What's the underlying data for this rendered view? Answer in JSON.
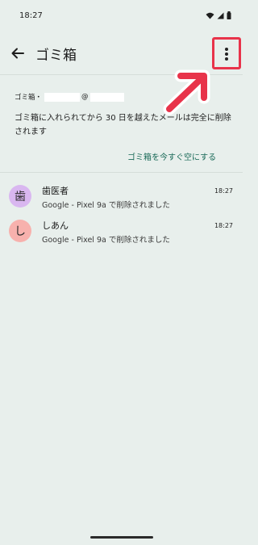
{
  "status": {
    "time": "18:27"
  },
  "app_bar": {
    "title": "ゴミ箱"
  },
  "account": {
    "label": "ゴミ箱・",
    "at": "@"
  },
  "notice": "ゴミ箱に入れられてから 30 日を越えたメールは完全に削除されます",
  "empty_trash_label": "ゴミ箱を今すぐ空にする",
  "items": [
    {
      "avatar": "歯",
      "avatar_color": "#d9b7f0",
      "sender": "歯医者",
      "time": "18:27",
      "snippet": "Google - Pixel 9a で削除されました"
    },
    {
      "avatar": "し",
      "avatar_color": "#f7b1ad",
      "sender": "しあん",
      "time": "18:27",
      "snippet": "Google - Pixel 9a で削除されました"
    }
  ],
  "colors": {
    "background": "#e8efec",
    "accent": "#1a6a58",
    "highlight": "#e8334a"
  }
}
